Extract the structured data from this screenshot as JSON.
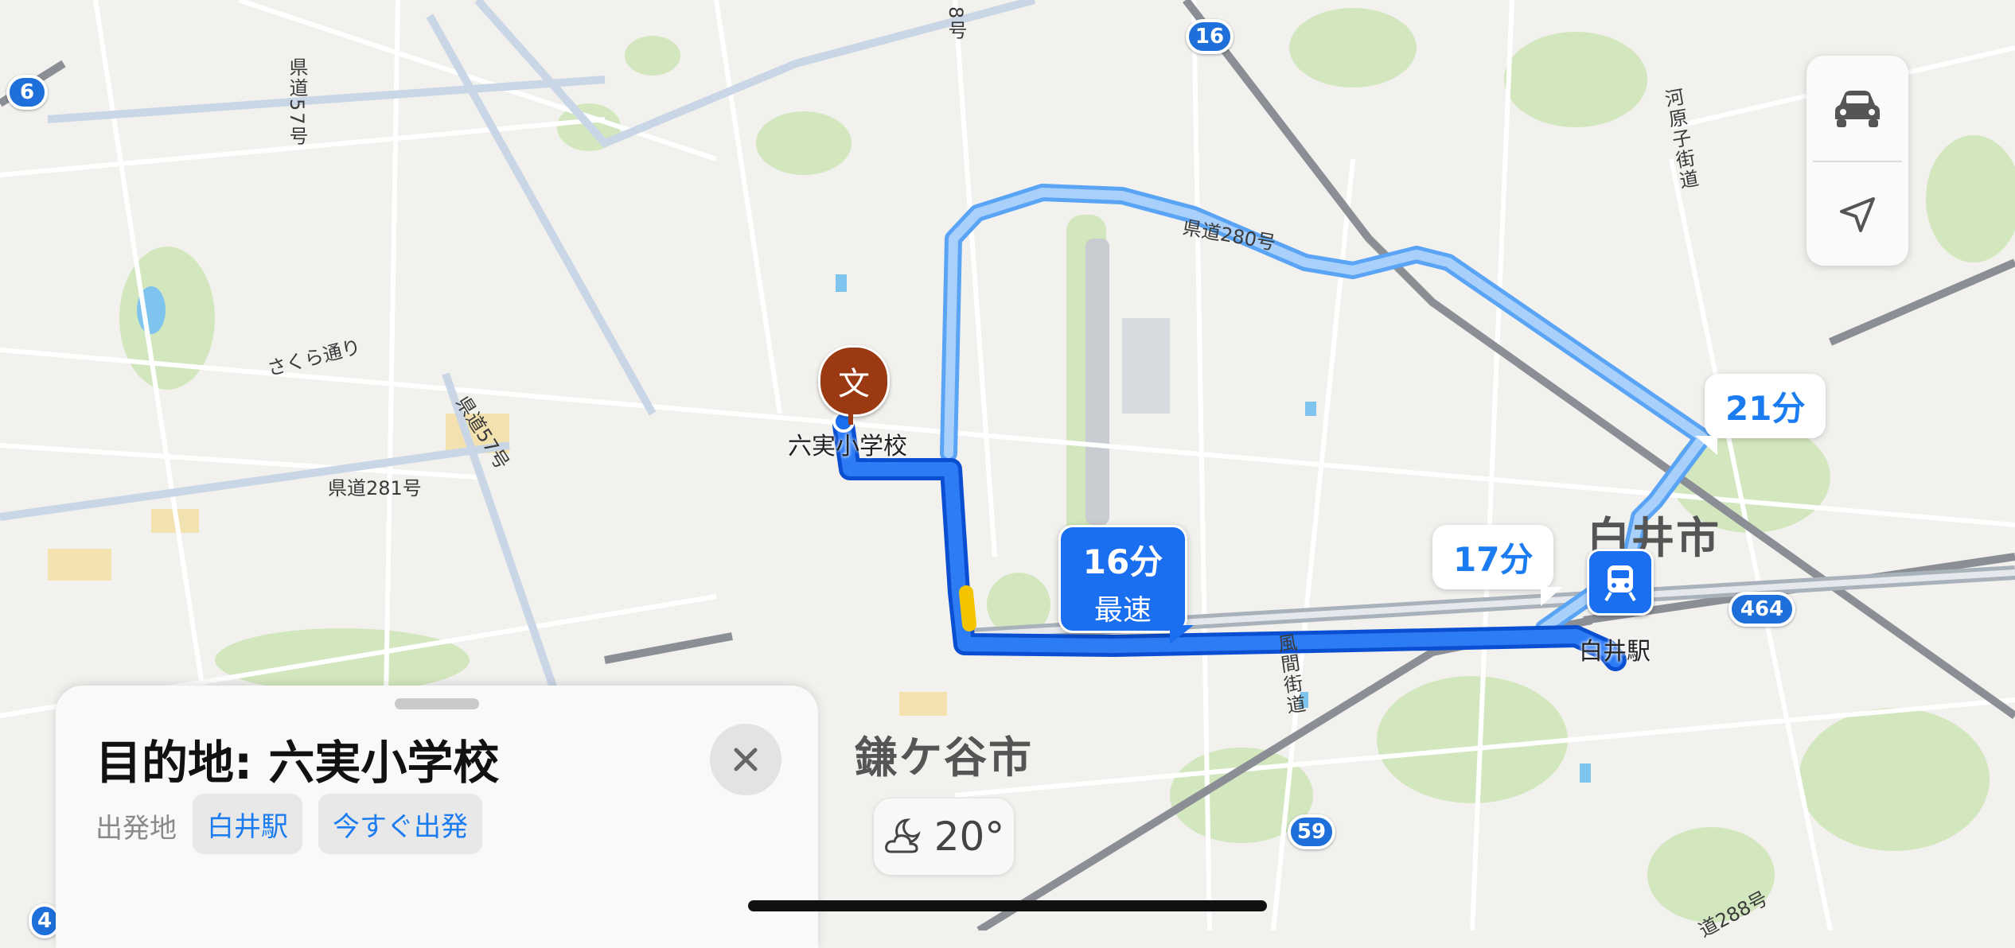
{
  "map": {
    "road_labels": {
      "r57_top": "県道57号",
      "r57_mid": "県道57号",
      "r281": "県道281号",
      "r280": "県道280号",
      "sakura": "さくら通り",
      "r8": "8号",
      "kawarago": "河原子街道",
      "kazama": "風間街道",
      "r288": "道288号"
    },
    "shields": {
      "s6": "6",
      "s16": "16",
      "s464": "464",
      "s59": "59",
      "s4": "4"
    },
    "place_labels": {
      "school": "六実小学校",
      "station": "白井駅",
      "city_shiroi": "白井市",
      "city_kamagaya": "鎌ケ谷市"
    },
    "route_bubbles": {
      "alt1": "21分",
      "alt2": "17分",
      "primary_time": "16分",
      "primary_tag": "最速"
    },
    "colors": {
      "route_primary": "#1a6ff0",
      "route_alt": "#8ec0f7",
      "land": "#f2f1ee",
      "green": "#cfe6b8",
      "pin": "#9b3a12"
    }
  },
  "controls": {
    "top_icon": "car-icon",
    "bottom_icon": "location-arrow-icon"
  },
  "sheet": {
    "title": "目的地: 六実小学校",
    "from_label": "出発地",
    "from_value": "白井駅",
    "depart_value": "今すぐ出発",
    "close_icon": "close-icon"
  },
  "weather": {
    "icon": "partly-cloudy-night-icon",
    "temp": "20°"
  }
}
